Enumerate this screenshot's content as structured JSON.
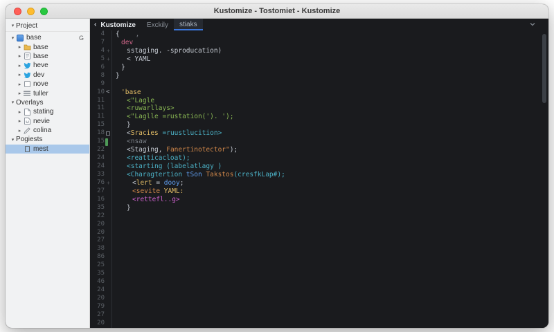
{
  "window": {
    "title": "Kustomize - Tostomiet - Kustomize"
  },
  "colors": {
    "accent_blue": "#3b77dd",
    "selection_blue": "#a9c8ea",
    "editor_bg": "#1a1b1e",
    "sidebar_bg": "#f1f2f3",
    "token_white": "#c6cbd3",
    "token_pink": "#d5688c",
    "token_yellow": "#e3bd66",
    "token_green": "#8ab854",
    "token_teal": "#4cb2c7",
    "token_blue": "#5f9ded",
    "token_orange": "#d2884a",
    "token_magenta": "#ce62ce",
    "gutter_change_green": "#4f9a58"
  },
  "sidebar": {
    "items": [
      {
        "type": "header",
        "arrow": "down",
        "label": "Project",
        "indent": 0
      },
      {
        "arrow": "down",
        "icon": "project-icon",
        "label": "base",
        "extra": "G",
        "indent": 0
      },
      {
        "arrow": "right",
        "icon": "folder-icon",
        "label": "base",
        "indent": 1
      },
      {
        "arrow": "right",
        "icon": "doc-icon",
        "label": "base",
        "indent": 1
      },
      {
        "arrow": "right",
        "icon": "bird-icon",
        "label": "heve",
        "indent": 1
      },
      {
        "arrow": "right",
        "icon": "bird-icon",
        "label": "dev",
        "indent": 1
      },
      {
        "arrow": "right",
        "icon": "square-icon",
        "label": "nove",
        "indent": 1
      },
      {
        "arrow": "right",
        "icon": "list-icon",
        "label": "tuller",
        "indent": 1
      },
      {
        "type": "section",
        "arrow": "down",
        "label": "Overlays",
        "indent": 0
      },
      {
        "arrow": "right",
        "icon": "page-icon",
        "label": "stating",
        "indent": 1
      },
      {
        "arrow": "right",
        "icon": "page-u-icon",
        "label": "nevie",
        "indent": 1
      },
      {
        "arrow": "right",
        "icon": "pencil-icon",
        "label": "colina",
        "indent": 1
      },
      {
        "type": "section",
        "arrow": "down",
        "label": "Pogiests",
        "indent": 0
      },
      {
        "icon": "file-icon",
        "label": "mest",
        "indent": 1,
        "selected": true
      }
    ]
  },
  "editor": {
    "tabs": [
      {
        "label": "Kustomize",
        "back": true,
        "first": true
      },
      {
        "label": "Exckily"
      },
      {
        "label": "stiaks",
        "active": true
      }
    ],
    "lines": [
      {
        "n": "4",
        "m": "",
        "i": 0,
        "t": [
          [
            "{",
            "w"
          ],
          [
            "    ,",
            "dim"
          ]
        ]
      },
      {
        "n": "7",
        "m": "",
        "i": 1,
        "t": [
          [
            "dev",
            "pink"
          ]
        ]
      },
      {
        "n": "4",
        "m": "plus",
        "i": 2,
        "t": [
          [
            "sstaging. -sproducation)",
            "w"
          ]
        ]
      },
      {
        "n": "5",
        "m": "plus",
        "i": 2,
        "t": [
          [
            "< YAML",
            "w"
          ]
        ]
      },
      {
        "n": "6",
        "m": "",
        "i": 1,
        "t": [
          [
            "}",
            "w"
          ]
        ]
      },
      {
        "n": "8",
        "m": "",
        "i": 0,
        "t": [
          [
            "}",
            "w"
          ]
        ]
      },
      {
        "n": "9",
        "m": "",
        "i": 0,
        "t": []
      },
      {
        "n": "10",
        "m": "fold",
        "i": 1,
        "t": [
          [
            "'base",
            "yellow"
          ]
        ]
      },
      {
        "n": "11",
        "m": "",
        "i": 2,
        "t": [
          [
            "<\"Lagle",
            "green"
          ]
        ]
      },
      {
        "n": "11",
        "m": "",
        "i": 2,
        "t": [
          [
            "<ruwarllays>",
            "green"
          ]
        ]
      },
      {
        "n": "11",
        "m": "",
        "i": 2,
        "t": [
          [
            "<\"Laglle =rustation('). ');",
            "green"
          ]
        ]
      },
      {
        "n": "15",
        "m": "",
        "i": 2,
        "t": [
          [
            "}",
            "w"
          ]
        ]
      },
      {
        "n": "18",
        "m": "box",
        "i": 2,
        "t": [
          [
            "<",
            "w"
          ],
          [
            "Sracies",
            "yellow"
          ],
          [
            " ",
            "w"
          ],
          [
            "=ruustlucition>",
            "teal"
          ]
        ]
      },
      {
        "n": "15",
        "m": "bar",
        "i": 2,
        "t": [
          [
            "<nsaw",
            "dim"
          ]
        ]
      },
      {
        "n": "22",
        "m": "",
        "i": 2,
        "t": [
          [
            "<Staging,",
            "w"
          ],
          [
            " ",
            "w"
          ],
          [
            "Fanertinotector\"",
            "orange"
          ],
          [
            ");",
            "w"
          ]
        ]
      },
      {
        "n": "24",
        "m": "",
        "i": 2,
        "t": [
          [
            "<reatticacloat);",
            "teal"
          ]
        ]
      },
      {
        "n": "24",
        "m": "",
        "i": 2,
        "t": [
          [
            "<starting (labelatlagy )",
            "teal"
          ]
        ]
      },
      {
        "n": "33",
        "m": "",
        "i": 2,
        "t": [
          [
            "<Charagtertion ",
            "teal"
          ],
          [
            "tSon ",
            "blue"
          ],
          [
            "Takstos",
            "orange"
          ],
          [
            "(cresfkLap#);",
            "teal"
          ]
        ]
      },
      {
        "n": "76",
        "m": "plus",
        "i": 3,
        "t": [
          [
            "<",
            "w"
          ],
          [
            "lert",
            "yellow"
          ],
          [
            " = ",
            "w"
          ],
          [
            "dooy",
            "blue"
          ],
          [
            ";",
            "w"
          ]
        ]
      },
      {
        "n": "27",
        "m": "",
        "i": 3,
        "t": [
          [
            "<sevite ",
            "orange"
          ],
          [
            "YAML:",
            "yellow"
          ]
        ]
      },
      {
        "n": "16",
        "m": "",
        "i": 3,
        "t": [
          [
            "<rettefl..g>",
            "magenta"
          ]
        ]
      },
      {
        "n": "35",
        "m": "",
        "i": 2,
        "t": [
          [
            "}",
            "w"
          ]
        ]
      },
      {
        "n": "22",
        "m": "",
        "i": 0,
        "t": []
      },
      {
        "n": "20",
        "m": "",
        "i": 0,
        "t": []
      },
      {
        "n": "20",
        "m": "",
        "i": 0,
        "t": []
      },
      {
        "n": "27",
        "m": "",
        "i": 0,
        "t": []
      },
      {
        "n": "38",
        "m": "",
        "i": 0,
        "t": []
      },
      {
        "n": "86",
        "m": "",
        "i": 0,
        "t": []
      },
      {
        "n": "25",
        "m": "",
        "i": 0,
        "t": []
      },
      {
        "n": "35",
        "m": "",
        "i": 0,
        "t": []
      },
      {
        "n": "46",
        "m": "",
        "i": 0,
        "t": []
      },
      {
        "n": "24",
        "m": "",
        "i": 0,
        "t": []
      },
      {
        "n": "20",
        "m": "",
        "i": 0,
        "t": []
      },
      {
        "n": "79",
        "m": "",
        "i": 0,
        "t": []
      },
      {
        "n": "27",
        "m": "",
        "i": 0,
        "t": []
      },
      {
        "n": "20",
        "m": "",
        "i": 0,
        "t": []
      }
    ]
  }
}
